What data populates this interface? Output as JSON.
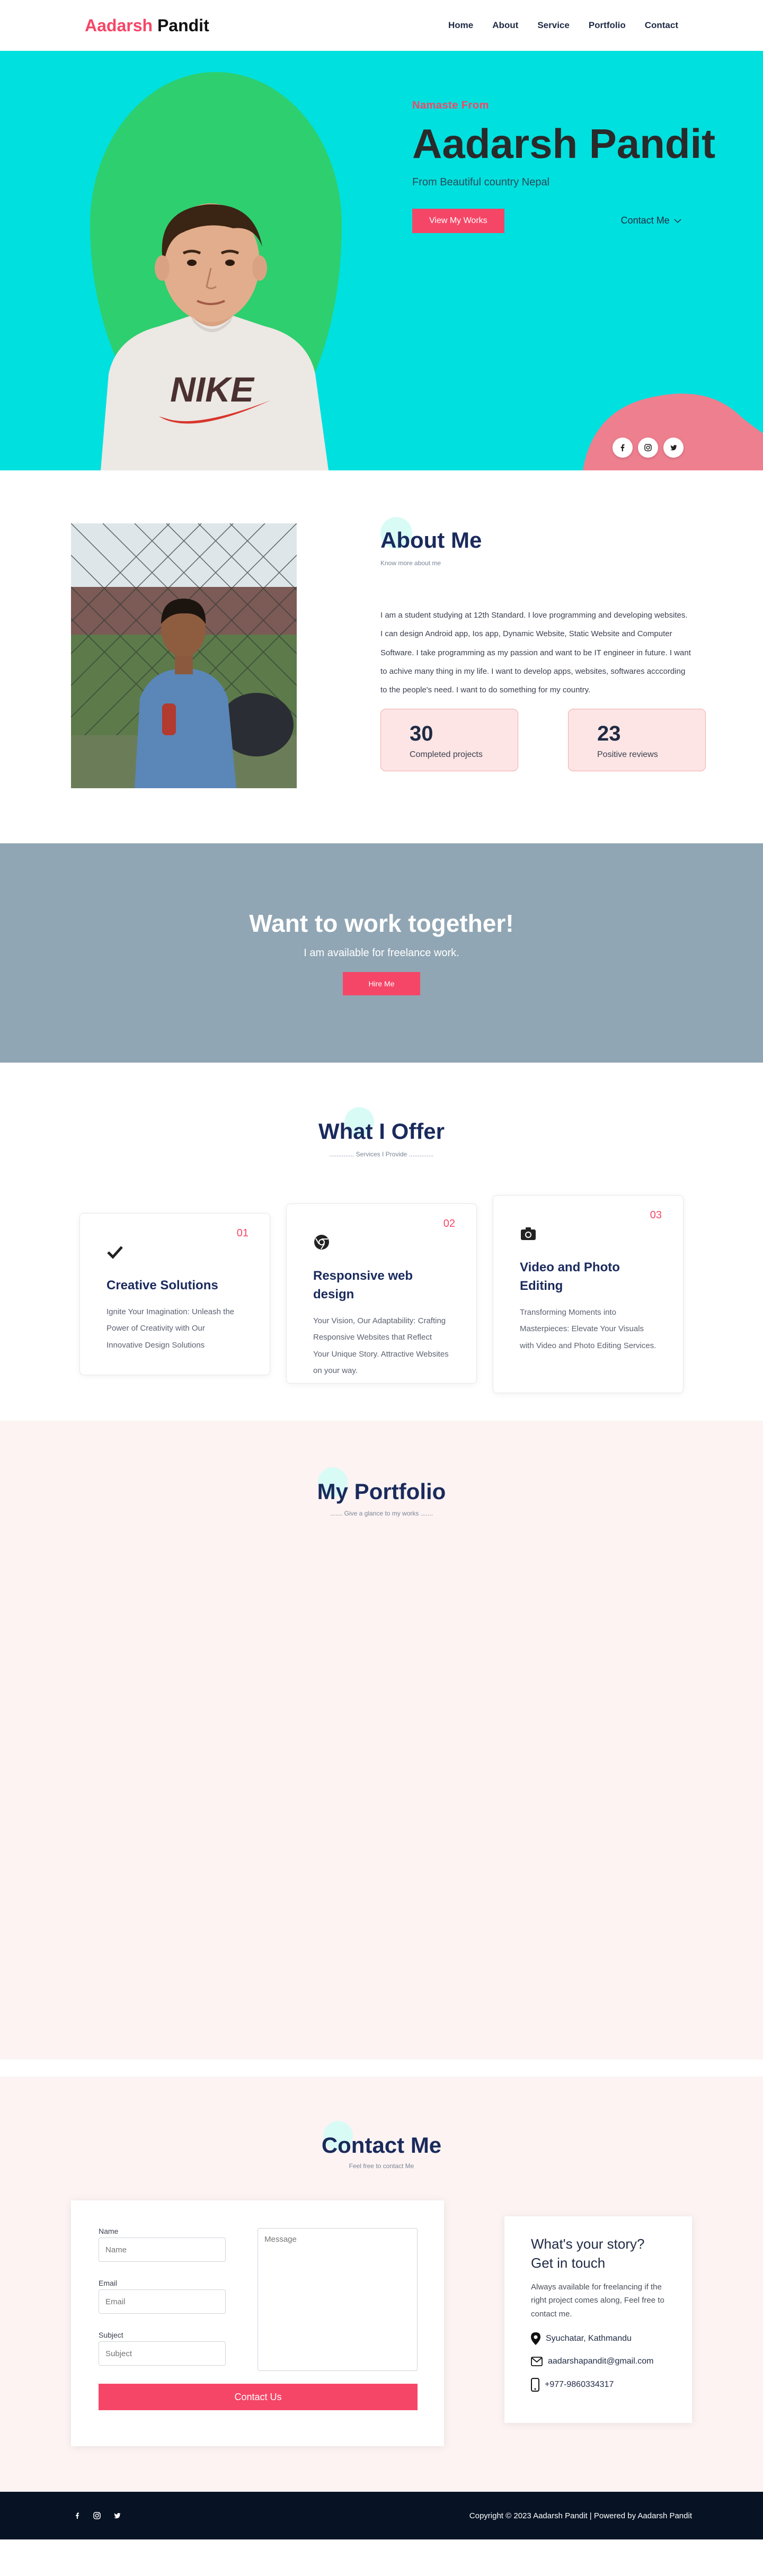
{
  "nav": {
    "logo_first": "Aadarsh",
    "logo_last": "Pandit",
    "links": [
      "Home",
      "About",
      "Service",
      "Portfolio",
      "Contact"
    ]
  },
  "hero": {
    "eyebrow": "Namaste From",
    "name": "Aadarsh Pandit",
    "subtitle": "From Beautiful country Nepal",
    "primary_button": "View My Works",
    "contact_link": "Contact Me",
    "shirt_text": "NIKE"
  },
  "about": {
    "title": "About Me",
    "subtitle": "Know more about me",
    "body": "I am a student studying at 12th Standard. I love programming and developing websites. I can design Android app, Ios app, Dynamic Website, Static Website and Computer Software. I take programming as my passion and want to be IT engineer in future. I want to achive many thing in my life. I want to develop apps, websites, softwares acccording to the people's need. I want to do something for my country.",
    "stats": [
      {
        "number": "30",
        "label": "Completed projects"
      },
      {
        "number": "23",
        "label": "Positive reviews"
      }
    ]
  },
  "hire": {
    "title": "Want to work together!",
    "subtitle": "I am available for freelance work.",
    "button": "Hire Me"
  },
  "services": {
    "title": "What I Offer",
    "subtitle": "Services I Provide",
    "cards": [
      {
        "number": "01",
        "icon": "check-icon",
        "title": "Creative Solutions",
        "text": "Ignite Your Imagination: Unleash the Power of Creativity with Our Innovative Design Solutions"
      },
      {
        "number": "02",
        "icon": "chrome-icon",
        "title": "Responsive web design",
        "text": "Your Vision, Our Adaptability: Crafting Responsive Websites that Reflect Your Unique Story. Attractive Websites on your way."
      },
      {
        "number": "03",
        "icon": "camera-icon",
        "title": "Video and Photo Editing",
        "text": "Transforming Moments into Masterpieces: Elevate Your Visuals with Video and Photo Editing Services."
      }
    ]
  },
  "portfolio": {
    "title": "My Portfolio",
    "subtitle": "Give a glance to my works"
  },
  "contact": {
    "title": "Contact Me",
    "subtitle": "Feel free to contact Me",
    "form": {
      "name_label": "Name",
      "name_placeholder": "Name",
      "email_label": "Email",
      "email_placeholder": "Email",
      "subject_label": "Subject",
      "subject_placeholder": "Subject",
      "message_placeholder": "Message",
      "submit": "Contact Us"
    },
    "story": {
      "title": "What's your story? Get in touch",
      "text": "Always available for freelancing if the right project comes along, Feel free to contact me.",
      "address": "Syuchatar, Kathmandu",
      "email": "aadarshapandit@gmail.com",
      "phone": "+977-9860334317"
    }
  },
  "footer": {
    "copyright": "Copyright © 2023 Aadarsh Pandit | Powered by Aadarsh Pandit",
    "socials": [
      "facebook-icon",
      "instagram-icon",
      "twitter-icon"
    ]
  },
  "colors": {
    "accent": "#f64667",
    "hero_bg": "#00e0de",
    "hero_blob": "#2ecf6e",
    "hire_bg": "#91a6b4",
    "soft_bg": "#fcf3f2",
    "footer_bg": "#071324",
    "heading": "#1a2a5c"
  }
}
